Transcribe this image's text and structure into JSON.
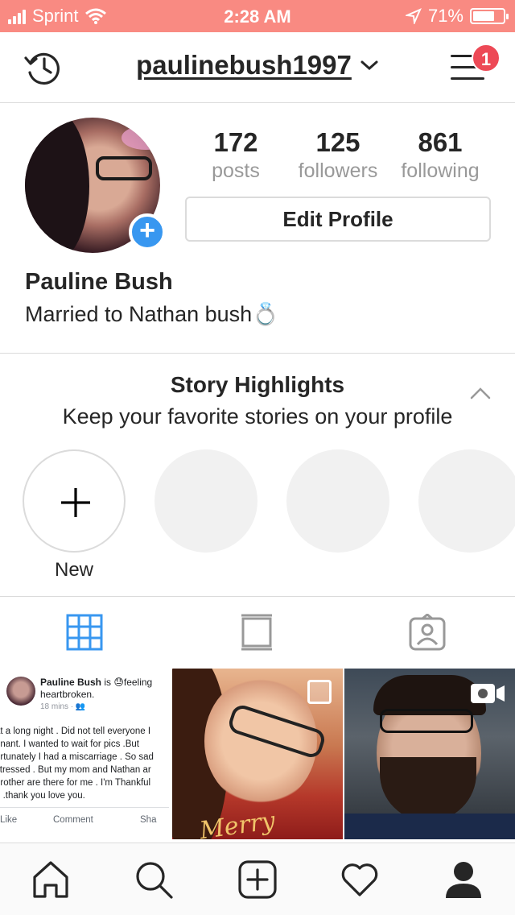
{
  "status_bar": {
    "carrier": "Sprint",
    "time": "2:28 AM",
    "battery": "71%",
    "battery_level": 0.71,
    "background_color": "#f98a82"
  },
  "header": {
    "username": "paulinebush1997",
    "notification_count": "1"
  },
  "profile": {
    "stats": [
      {
        "value": "172",
        "label": "posts"
      },
      {
        "value": "125",
        "label": "followers"
      },
      {
        "value": "861",
        "label": "following"
      }
    ],
    "edit_button": "Edit Profile",
    "full_name": "Pauline Bush",
    "bio": "Married to Nathan bush💍"
  },
  "highlights": {
    "title": "Story Highlights",
    "subtitle": "Keep your favorite stories on your profile",
    "new_label": "New"
  },
  "tabs": [
    {
      "icon": "grid-icon",
      "active": true
    },
    {
      "icon": "feed-icon",
      "active": false
    },
    {
      "icon": "tagged-icon",
      "active": false
    }
  ],
  "posts": {
    "fb_post": {
      "name": "Pauline Bush",
      "status": " is 😓feeling heartbroken.",
      "time": "18 mins · 👥",
      "text_lines": [
        "at a long night . Did not tell everyone I",
        "gnant.  I wanted to wait for pics .But",
        "ortunately I had  a miscarriage . So sad",
        "stressed . But my mom and Nathan ar",
        "brother are there for me . I'm Thankful",
        "n .thank you love you."
      ],
      "actions": [
        "Like",
        "Comment",
        "Sha"
      ]
    },
    "photo_caption": "Merry Xmas"
  },
  "bottom_nav": [
    "home-icon",
    "search-icon",
    "add-post-icon",
    "activity-heart-icon",
    "profile-icon"
  ],
  "colors": {
    "accent_blue": "#3897f0",
    "badge_red": "#ed4956",
    "text_dark": "#262626",
    "text_gray": "#999999",
    "border": "#dbdbdb"
  }
}
